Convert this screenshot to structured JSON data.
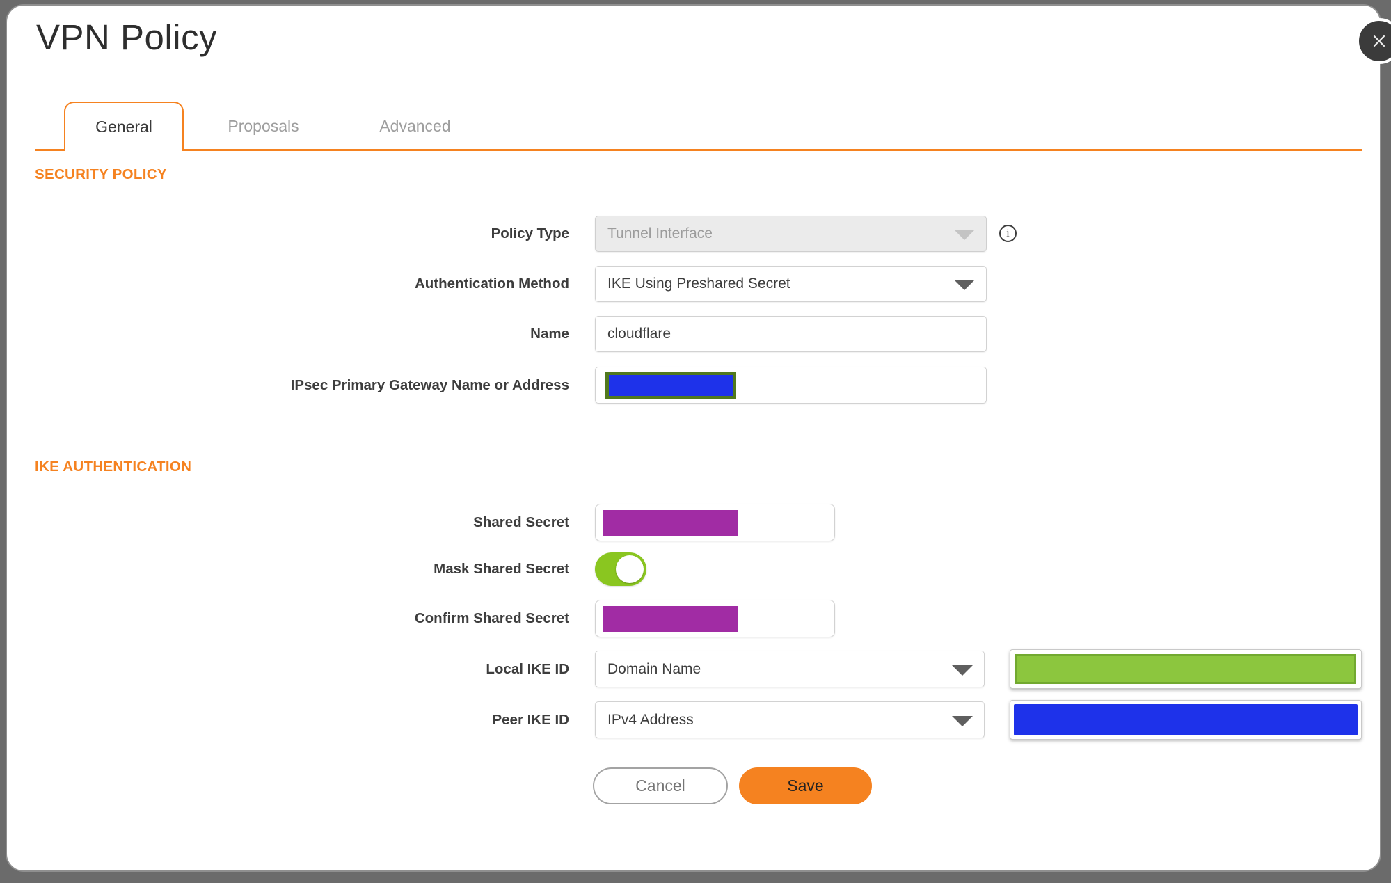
{
  "colors": {
    "accent": "#F58220",
    "backdrop": "#6B6B6B",
    "redaction_blue": "#1E32EA",
    "redaction_purple": "#A12CA4",
    "redaction_green": "#8CC63E",
    "redaction_green_border": "#72A930",
    "gateway_redaction_border": "#51791E",
    "toggle_on_green": "#8AC620"
  },
  "modal": {
    "title": "VPN Policy"
  },
  "tabs": [
    {
      "label": "General",
      "active": true
    },
    {
      "label": "Proposals",
      "active": false
    },
    {
      "label": "Advanced",
      "active": false
    }
  ],
  "sections": {
    "security_policy": "SECURITY POLICY",
    "ike_authentication": "IKE AUTHENTICATION"
  },
  "fields": {
    "policy_type": {
      "label": "Policy Type",
      "value": "Tunnel Interface",
      "disabled": true
    },
    "auth_method": {
      "label": "Authentication Method",
      "value": "IKE Using Preshared Secret"
    },
    "name": {
      "label": "Name",
      "value": "cloudflare"
    },
    "gateway": {
      "label": "IPsec Primary Gateway Name or Address",
      "value": "",
      "redacted": true
    },
    "shared_secret": {
      "label": "Shared Secret",
      "value": "",
      "redacted": true
    },
    "mask_shared_secret": {
      "label": "Mask Shared Secret",
      "enabled": true
    },
    "confirm_shared_secret": {
      "label": "Confirm Shared Secret",
      "value": "",
      "redacted": true
    },
    "local_ike_id": {
      "label": "Local IKE ID",
      "value": "Domain Name",
      "id_value_redacted": true
    },
    "peer_ike_id": {
      "label": "Peer IKE ID",
      "value": "IPv4 Address",
      "id_value_redacted": true
    }
  },
  "buttons": {
    "cancel": "Cancel",
    "save": "Save"
  },
  "icons": {
    "info": "i"
  }
}
